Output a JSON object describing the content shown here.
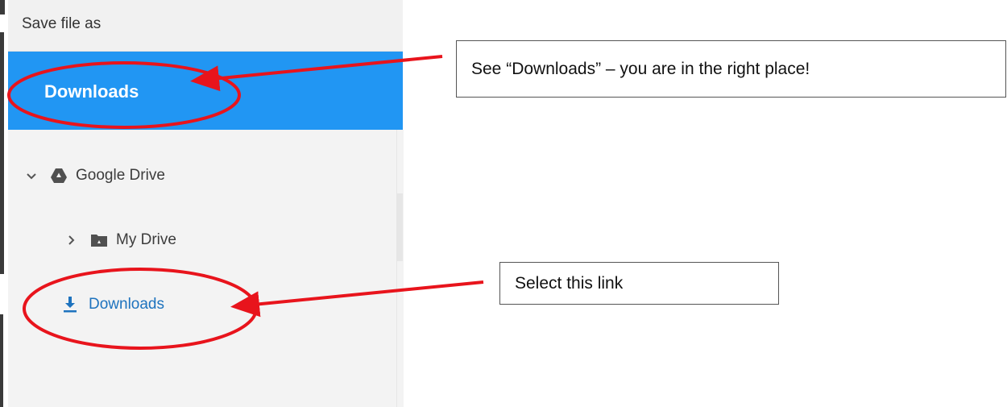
{
  "dialog": {
    "title": "Save file as",
    "header_label": "Downloads"
  },
  "nav": {
    "items": [
      {
        "label": "Google Drive",
        "icon": "google-drive-icon",
        "expander": "chevron-down-icon"
      },
      {
        "label": "My Drive",
        "icon": "shared-drive-folder-icon",
        "expander": "chevron-right-icon"
      },
      {
        "label": "Downloads",
        "icon": "download-icon",
        "expander": ""
      }
    ]
  },
  "annotations": {
    "callout_1": "See “Downloads” – you are in the right place!",
    "callout_2": "Select this link"
  },
  "colors": {
    "header_blue": "#2196f3",
    "link_blue": "#1e73be",
    "annotation_red": "#e8141c"
  }
}
